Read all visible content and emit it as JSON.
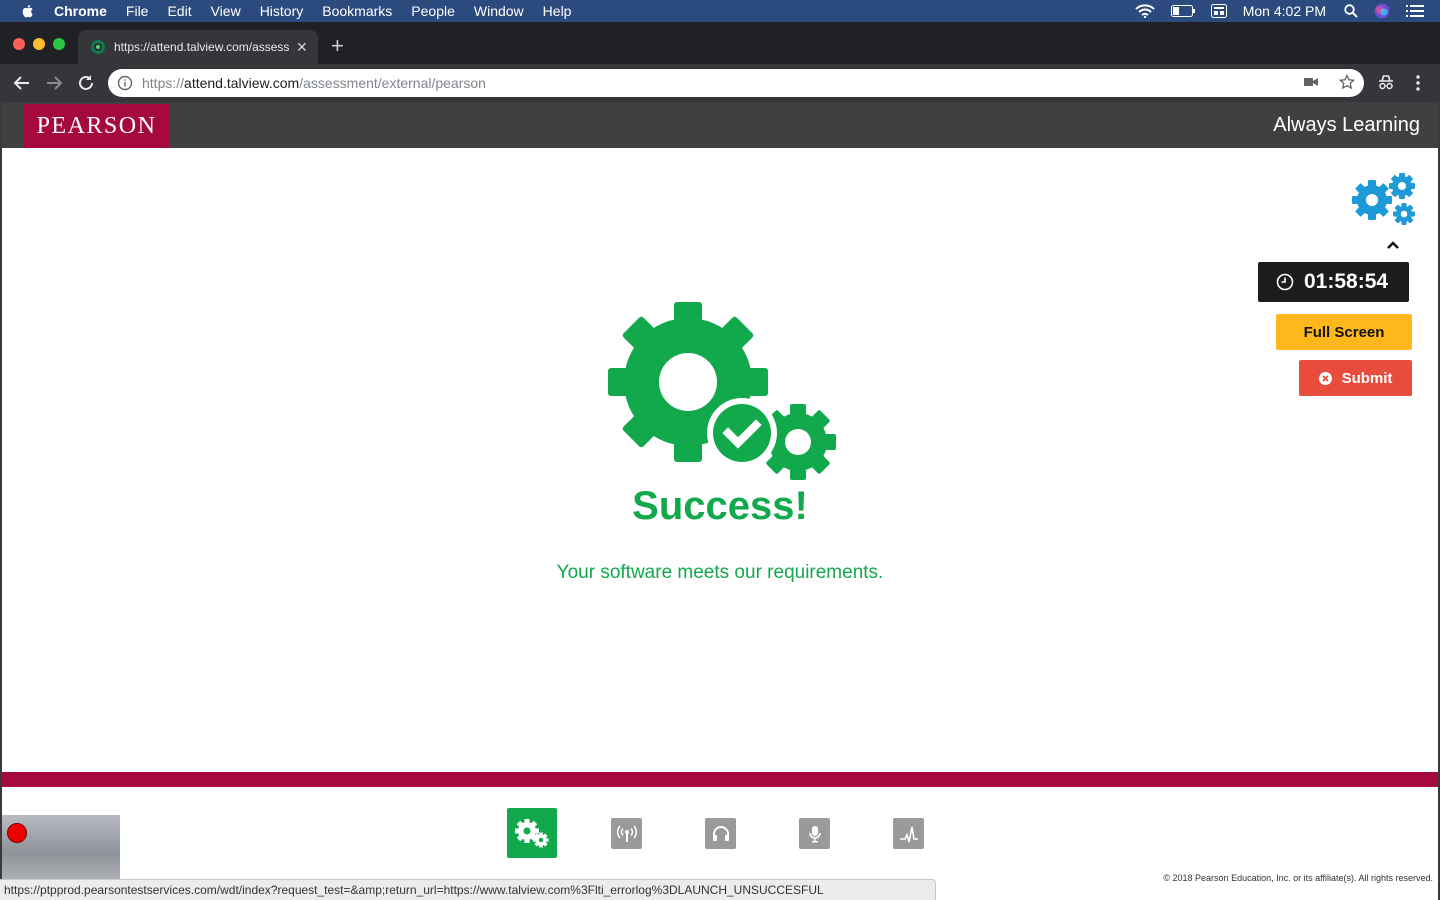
{
  "menubar": {
    "app": "Chrome",
    "items": [
      "File",
      "Edit",
      "View",
      "History",
      "Bookmarks",
      "People",
      "Window",
      "Help"
    ],
    "clock": "Mon 4:02 PM"
  },
  "browser": {
    "tab_title": "https://attend.talview.com/assessment/external/pearson",
    "url_scheme": "https://",
    "url_host": "attend.talview.com",
    "url_path": "/assessment/external/pearson"
  },
  "header": {
    "logo": "PEARSON",
    "tagline": "Always Learning"
  },
  "sidebar": {
    "timer": "01:58:54",
    "fullscreen_label": "Full Screen",
    "submit_label": "Submit"
  },
  "main": {
    "title": "Success!",
    "message": "Your software meets our requirements."
  },
  "steps": [
    {
      "icon": "gears-icon",
      "active": true
    },
    {
      "icon": "signal-icon",
      "active": false
    },
    {
      "icon": "headphones-icon",
      "active": false
    },
    {
      "icon": "microphone-icon",
      "active": false
    },
    {
      "icon": "waveform-icon",
      "active": false
    }
  ],
  "footer": {
    "copyright": "© 2018 Pearson Education, Inc. or its affiliate(s). All rights reserved."
  },
  "statusbar": {
    "link_url": "https://ptpprod.pearsontestservices.com/wdt/index?request_test=&amp;return_url=https://www.talview.com%3Flti_errorlog%3DLAUNCH_UNSUCCESFUL"
  },
  "colors": {
    "brand": "#a6093f",
    "success": "#12a94c",
    "fullscreen": "#ffb81c",
    "submit": "#e84c3d",
    "gear_blue": "#1e9ad6"
  }
}
